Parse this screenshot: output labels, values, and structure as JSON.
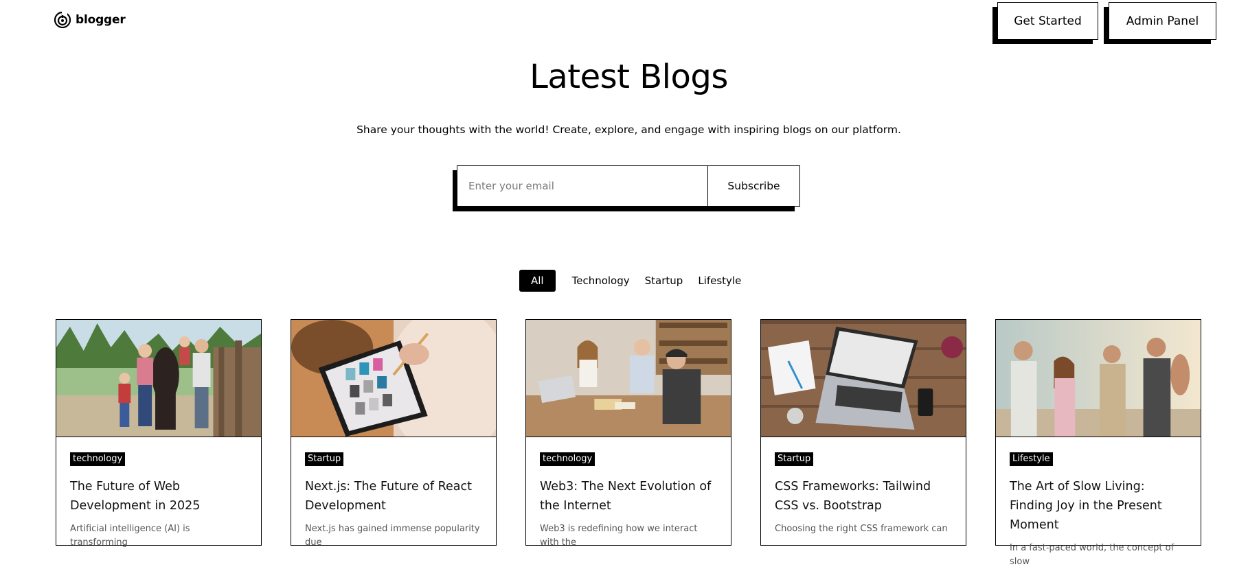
{
  "header": {
    "brand_name": "blogger",
    "brand_icon": "blogger-logo-icon",
    "get_started_label": "Get Started",
    "admin_panel_label": "Admin Panel"
  },
  "hero": {
    "title": "Latest Blogs",
    "subtitle": "Share your thoughts with the world! Create, explore, and engage with inspiring blogs on our platform.",
    "email_placeholder": "Enter your email",
    "subscribe_label": "Subscribe"
  },
  "filters": {
    "items": [
      "All",
      "Technology",
      "Startup",
      "Lifestyle"
    ],
    "active": "All"
  },
  "blogs": [
    {
      "category": "technology",
      "title": "The Future of Web Development in 2025",
      "excerpt": "Artificial intelligence (AI) is transforming",
      "image": "family-with-horse-photo"
    },
    {
      "category": "Startup",
      "title": "Next.js: The Future of React Development",
      "excerpt": "Next.js has gained immense popularity due",
      "image": "tablet-drawing-photo"
    },
    {
      "category": "technology",
      "title": "Web3: The Next Evolution of the Internet",
      "excerpt": "Web3 is redefining how we interact with the",
      "image": "team-meeting-photo"
    },
    {
      "category": "Startup",
      "title": "CSS Frameworks: Tailwind CSS vs. Bootstrap",
      "excerpt": "Choosing the right CSS framework can",
      "image": "laptop-desk-photo"
    },
    {
      "category": "Lifestyle",
      "title": "The Art of Slow Living: Finding Joy in the Present Moment",
      "excerpt": "In a fast-paced world, the concept of slow",
      "image": "friends-sunset-photo"
    }
  ],
  "colors": {
    "text": "#000000",
    "background": "#ffffff",
    "accent": "#000000"
  }
}
